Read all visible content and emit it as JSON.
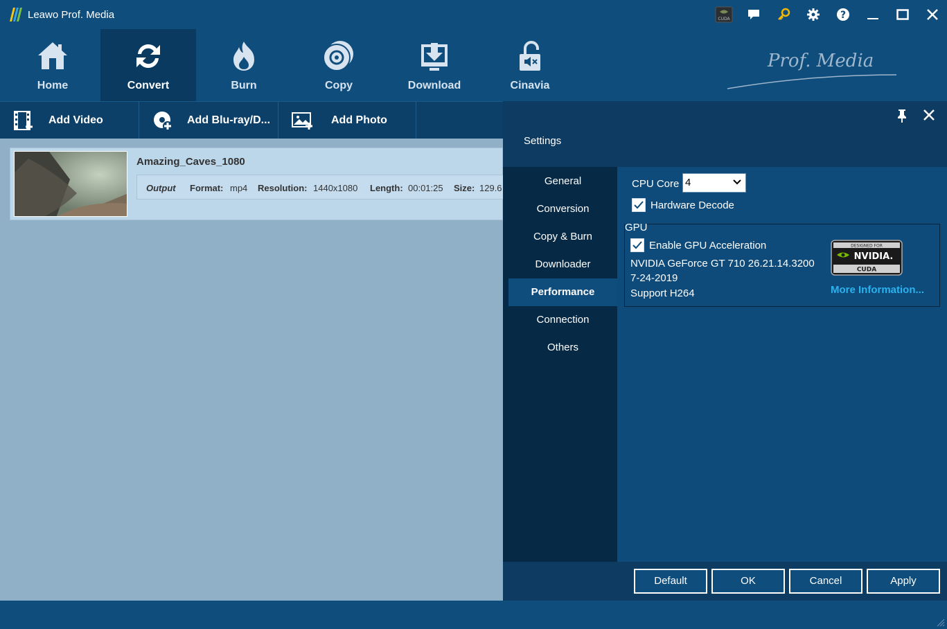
{
  "app": {
    "title": "Leawo Prof. Media"
  },
  "titlebar_icons": [
    "cuda-icon",
    "feedback-icon",
    "key-icon",
    "gear-icon",
    "help-icon",
    "minimize-icon",
    "maximize-icon",
    "close-icon"
  ],
  "cuda_badge_text": "CUDA",
  "nav": {
    "items": [
      {
        "label": "Home",
        "icon": "home-icon"
      },
      {
        "label": "Convert",
        "icon": "convert-icon",
        "active": true
      },
      {
        "label": "Burn",
        "icon": "burn-icon"
      },
      {
        "label": "Copy",
        "icon": "copy-icon"
      },
      {
        "label": "Download",
        "icon": "download-icon"
      },
      {
        "label": "Cinavia",
        "icon": "cinavia-icon"
      }
    ],
    "logo_text": "Prof. Media"
  },
  "toolbar": {
    "add_video": "Add Video",
    "add_bluray": "Add Blu-ray/D...",
    "add_photo": "Add Photo"
  },
  "video": {
    "name": "Amazing_Caves_1080",
    "output_label": "Output",
    "format_label": "Format:",
    "format": "mp4",
    "resolution_label": "Resolution:",
    "resolution": "1440x1080",
    "length_label": "Length:",
    "length": "00:01:25",
    "size_label": "Size:",
    "size": "129.6"
  },
  "settings": {
    "title": "Settings",
    "menu": [
      "General",
      "Conversion",
      "Copy & Burn",
      "Downloader",
      "Performance",
      "Connection",
      "Others"
    ],
    "active_menu": "Performance",
    "cpu_core_label": "CPU Core",
    "cpu_core_value": "4",
    "hardware_decode_label": "Hardware Decode",
    "hardware_decode_checked": true,
    "gpu_group_label": "GPU",
    "enable_gpu_label": "Enable GPU Acceleration",
    "enable_gpu_checked": true,
    "gpu_name": "NVIDIA GeForce GT 710 26.21.14.3200",
    "gpu_date": "7-24-2019",
    "gpu_support": "Support H264",
    "nvidia_badge": {
      "top": "DESIGNED FOR",
      "brand": "NVIDIA.",
      "bottom": "CUDA"
    },
    "more_info": "More Information...",
    "buttons": {
      "default": "Default",
      "ok": "OK",
      "cancel": "Cancel",
      "apply": "Apply"
    }
  },
  "colors": {
    "accent": "#0f4d7d",
    "panel_dark": "#062a45",
    "link": "#2ab3ef",
    "content_bg": "#8fb0c6"
  }
}
